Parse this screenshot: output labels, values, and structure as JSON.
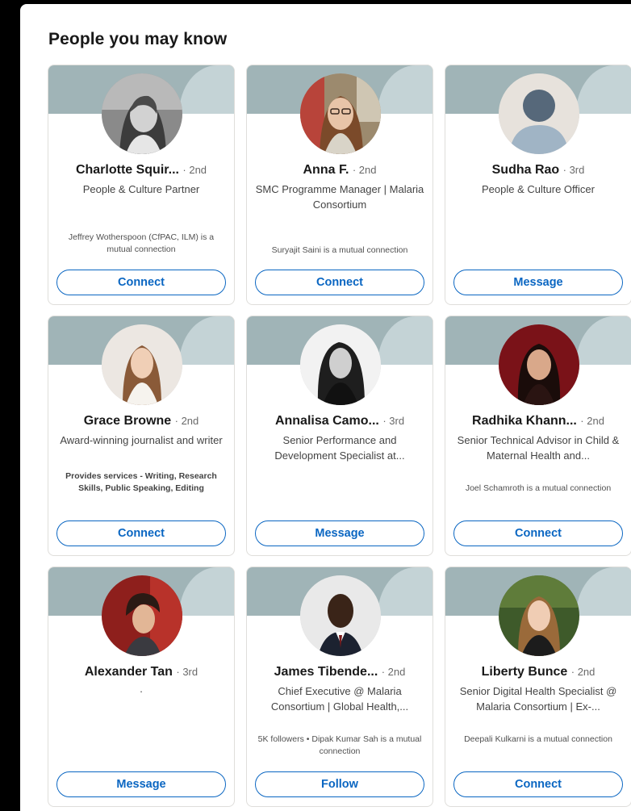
{
  "section": {
    "title": "People you may know"
  },
  "people": [
    {
      "name": "Charlotte Squir...",
      "degree": "· 2nd",
      "headline": "People & Culture Partner",
      "insight": "Jeffrey Wotherspoon (CfPAC, ILM) is a mutual connection",
      "insight_bold": false,
      "action": "Connect",
      "avatar_style": "gray-woman"
    },
    {
      "name": "Anna F.",
      "degree": "· 2nd",
      "headline": "SMC Programme Manager | Malaria Consortium",
      "insight": "Suryajit Saini is a mutual connection",
      "insight_bold": false,
      "action": "Connect",
      "avatar_style": "woman-glasses"
    },
    {
      "name": "Sudha Rao",
      "degree": "· 3rd",
      "headline": "People & Culture Officer",
      "insight": "",
      "insight_bold": false,
      "action": "Message",
      "avatar_style": "placeholder"
    },
    {
      "name": "Grace Browne",
      "degree": "· 2nd",
      "headline": "Award-winning journalist and writer",
      "insight": "Provides services - Writing, Research Skills, Public Speaking, Editing",
      "insight_bold": true,
      "action": "Connect",
      "avatar_style": "woman-light"
    },
    {
      "name": "Annalisa Camo...",
      "degree": "· 3rd",
      "headline": "Senior Performance and Development Specialist at...",
      "insight": "",
      "insight_bold": false,
      "action": "Message",
      "avatar_style": "bw-woman"
    },
    {
      "name": "Radhika Khann...",
      "degree": "· 2nd",
      "headline": "Senior Technical Advisor in Child & Maternal Health and...",
      "insight": "Joel Schamroth is a mutual connection",
      "insight_bold": false,
      "action": "Connect",
      "avatar_style": "woman-red"
    },
    {
      "name": "Alexander Tan",
      "degree": "· 3rd",
      "headline": "·",
      "insight": "",
      "insight_bold": false,
      "action": "Message",
      "avatar_style": "man-red"
    },
    {
      "name": "James Tibende...",
      "degree": "· 2nd",
      "headline": "Chief Executive @ Malaria Consortium | Global Health,...",
      "insight": "5K followers • Dipak Kumar Sah is a mutual connection",
      "insight_bold": false,
      "action": "Follow",
      "avatar_style": "man-suit"
    },
    {
      "name": "Liberty Bunce",
      "degree": "· 2nd",
      "headline": "Senior Digital Health Specialist @ Malaria Consortium | Ex-...",
      "insight": "Deepali Kulkarni is a mutual connection",
      "insight_bold": false,
      "action": "Connect",
      "avatar_style": "woman-green"
    }
  ],
  "colors": {
    "accent": "#0a66c2",
    "banner": "#a0b4b7",
    "banner_light": "#c4d3d6"
  }
}
